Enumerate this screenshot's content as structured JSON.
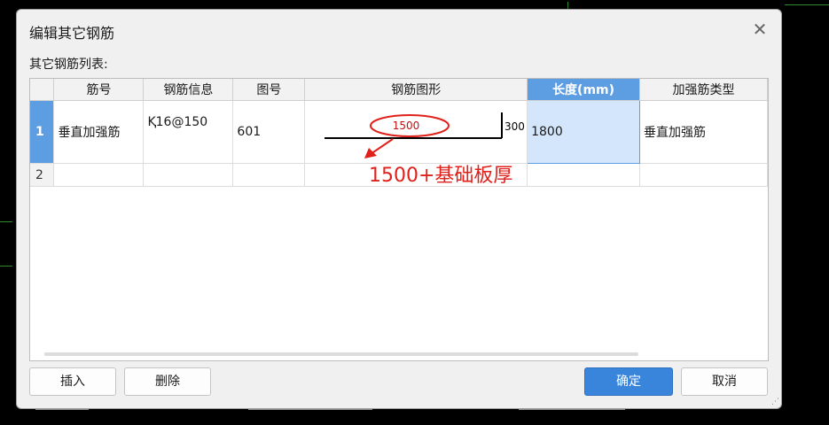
{
  "dialog": {
    "title": "编辑其它钢筋",
    "list_label": "其它钢筋列表:"
  },
  "table": {
    "headers": [
      "筋号",
      "钢筋信息",
      "图号",
      "钢筋图形",
      "长度(mm)",
      "加强筋类型"
    ],
    "active_header": "长度(mm)",
    "rows": [
      {
        "num": "1",
        "rebar_no": "垂直加强筋",
        "rebar_info": "Ⱪ16@150",
        "figure_no": "601",
        "shape_main_value": "1500",
        "shape_hook_value": "300",
        "length": "1800",
        "type": "垂直加强筋"
      },
      {
        "num": "2",
        "rebar_no": "",
        "rebar_info": "",
        "figure_no": "",
        "length": "",
        "type": ""
      }
    ]
  },
  "buttons": {
    "insert": "插入",
    "delete": "删除",
    "ok": "确定",
    "cancel": "取消"
  },
  "annotation": {
    "text": "1500+基础板厚",
    "color": "#e0201a"
  },
  "icons": {
    "close": "close-icon",
    "resize": "resize-grip-icon"
  },
  "colors": {
    "accent": "#5d9ee3",
    "primary_button": "#3a85dc",
    "selected_cell": "#d3e6fb",
    "annotation_red": "#e0201a"
  }
}
